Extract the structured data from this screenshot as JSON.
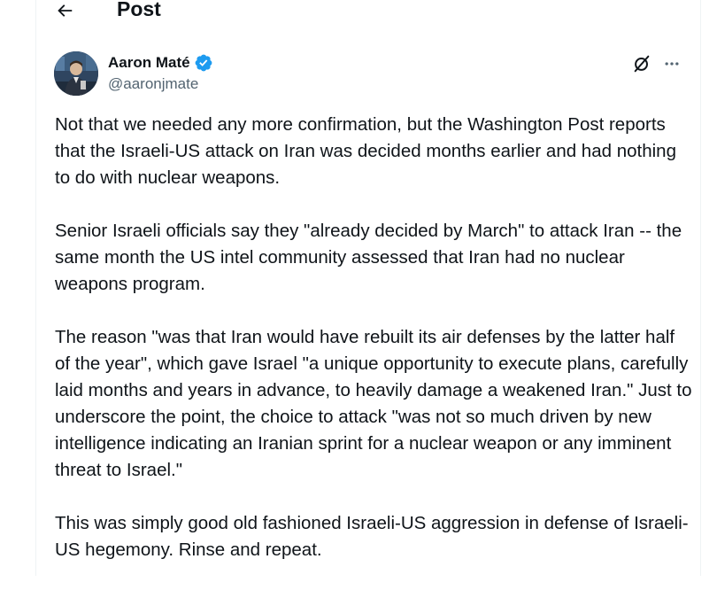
{
  "header": {
    "title": "Post",
    "back_icon": "arrow-left-icon"
  },
  "author": {
    "name": "Aaron Maté",
    "handle": "@aaronjmate",
    "verified": true,
    "verified_color": "#1d9bf0"
  },
  "actions": {
    "grok_icon": "grok-icon",
    "more_icon": "more-horizontal-icon"
  },
  "tweet": {
    "paragraphs": [
      "Not that we needed any more confirmation, but the Washington Post reports that the Israeli-US attack on Iran was decided months earlier and had nothing to do with nuclear weapons.",
      "Senior Israeli officials say they \"already decided by March\" to attack Iran -- the same month the US intel community assessed that Iran had no nuclear weapons program.",
      "The reason \"was that Iran would have rebuilt its air defenses by the latter half of the year\", which gave Israel \"a unique opportunity to execute plans, carefully laid months and years in advance, to heavily damage a weakened Iran.\" Just to underscore the point, the choice to attack \"was not so much driven by new intelligence indicating an Iranian sprint for a nuclear weapon or any imminent threat to Israel.\"",
      "This was simply good old fashioned Israeli-US aggression in defense of Israeli-US hegemony. Rinse and repeat."
    ]
  }
}
